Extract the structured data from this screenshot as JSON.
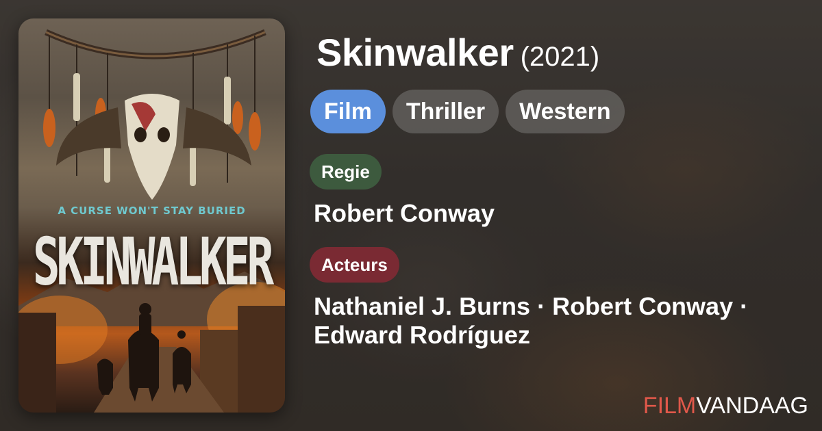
{
  "movie": {
    "title": "Skinwalker",
    "year": "(2021)"
  },
  "genres": [
    {
      "label": "Film",
      "active": true
    },
    {
      "label": "Thriller",
      "active": false
    },
    {
      "label": "Western",
      "active": false
    }
  ],
  "director": {
    "label": "Regie",
    "names": "Robert Conway"
  },
  "cast": {
    "label": "Acteurs",
    "names": "Nathaniel J. Burns · Robert Conway · Edward Rodríguez"
  },
  "poster": {
    "tagline": "A CURSE WON'T STAY BURIED",
    "title": "SKINWALKER"
  },
  "brand": {
    "part1": "FILM",
    "part2": "VANDAAG"
  },
  "colors": {
    "chip_active": "#5b8fdc",
    "label_regie": "#3d5a3e",
    "label_acteurs": "#7a2a33",
    "brand_accent": "#e0584a"
  }
}
